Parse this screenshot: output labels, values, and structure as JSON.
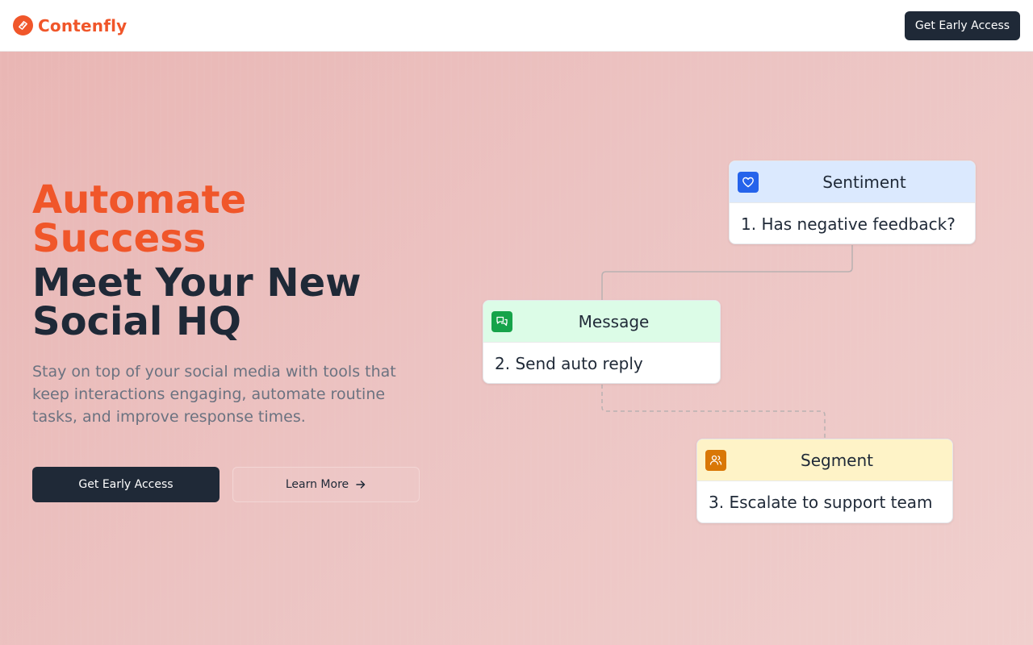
{
  "nav": {
    "brand_name": "Contenfly",
    "cta_label": "Get Early Access"
  },
  "hero": {
    "headline_accent_line1": "Automate",
    "headline_accent_line2": "Success",
    "headline_main_line1": "Meet Your New",
    "headline_main_line2": "Social HQ",
    "subtext": "Stay on top of your social media with tools that keep interactions engaging, automate routine tasks, and improve response times.",
    "primary_cta": "Get Early Access",
    "secondary_cta": "Learn More"
  },
  "flow": {
    "steps": [
      {
        "title": "Sentiment",
        "action": "1. Has negative feedback?",
        "icon": "heart-icon",
        "color": "#2563eb"
      },
      {
        "title": "Message",
        "action": "2. Send auto reply",
        "icon": "chat-bubbles-icon",
        "color": "#16a34a"
      },
      {
        "title": "Segment",
        "action": "3. Escalate to support team",
        "icon": "users-icon",
        "color": "#d97706"
      }
    ]
  },
  "colors": {
    "brand": "#f0562a",
    "dark": "#1f2937",
    "muted": "#6b7280"
  }
}
